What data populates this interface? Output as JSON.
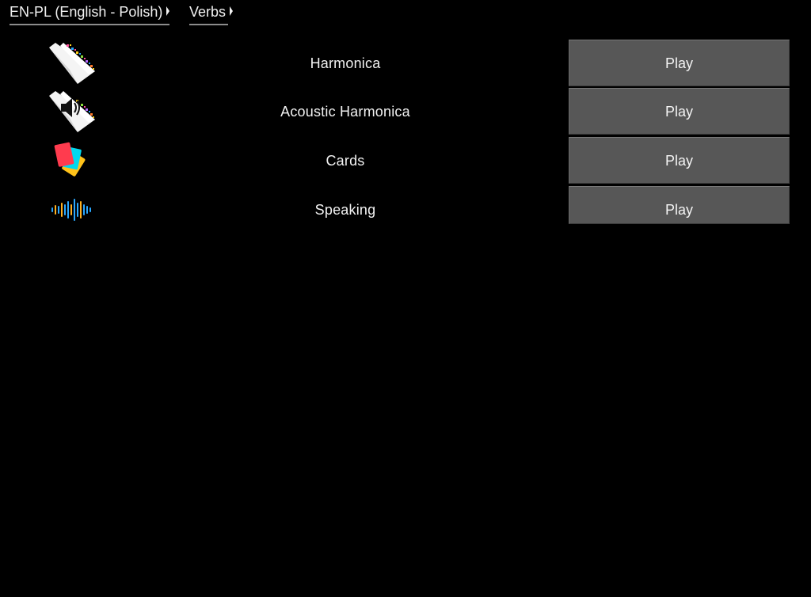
{
  "breadcrumb": {
    "items": [
      {
        "label": "EN-PL (English - Polish)"
      },
      {
        "label": "Verbs"
      }
    ]
  },
  "modes": [
    {
      "label": "Harmonica",
      "icon": "book-icon",
      "play_label": "Play"
    },
    {
      "label": "Acoustic Harmonica",
      "icon": "book-speaker-icon",
      "play_label": "Play"
    },
    {
      "label": "Cards",
      "icon": "cards-icon",
      "play_label": "Play"
    },
    {
      "label": "Speaking",
      "icon": "soundwave-icon",
      "play_label": "Play"
    }
  ],
  "colors": {
    "background": "#000000",
    "button_bg": "#575757",
    "text": "#f2f2f2",
    "card_red": "#ff3b4e",
    "card_cyan": "#00d8ee",
    "card_yellow": "#ffc21a"
  }
}
